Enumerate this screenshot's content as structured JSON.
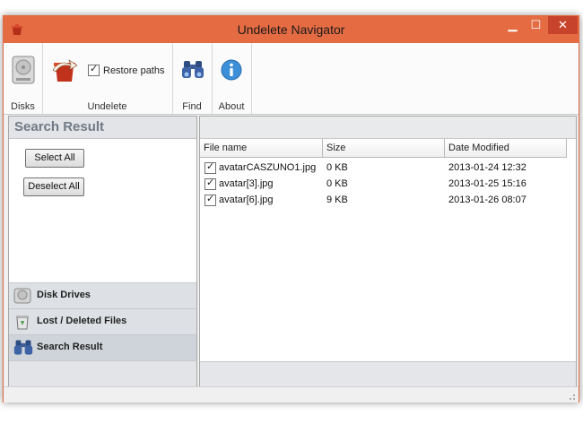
{
  "window": {
    "title": "Undelete Navigator",
    "accent": "#e56b43"
  },
  "controls": {
    "minimize": "▁",
    "maximize": "☐",
    "close": "✕"
  },
  "ribbon": {
    "disks_label": "Disks",
    "undelete_label": "Undelete",
    "restore_paths_label": "Restore paths",
    "restore_paths_checked": true,
    "find_label": "Find",
    "about_label": "About",
    "icons": [
      "hard-disk-icon",
      "undelete-trash-icon",
      "binoculars-icon",
      "info-icon"
    ]
  },
  "left_panel": {
    "header": "Search Result",
    "select_all": "Select All",
    "deselect_all": "Deselect All",
    "nav": [
      {
        "label": "Disk Drives",
        "icon": "hard-disk-icon"
      },
      {
        "label": "Lost / Deleted Files",
        "icon": "recycle-bin-icon"
      },
      {
        "label": "Search Result",
        "icon": "binoculars-icon",
        "active": true
      }
    ]
  },
  "file_list": {
    "columns": [
      "File name",
      "Size",
      "Date Modified"
    ],
    "rows": [
      {
        "checked": true,
        "name": "avatarCASZUNO1.jpg",
        "size": "0 KB",
        "date": "2013-01-24  12:32"
      },
      {
        "checked": true,
        "name": "avatar[3].jpg",
        "size": "0 KB",
        "date": "2013-01-25  15:16"
      },
      {
        "checked": true,
        "name": "avatar[6].jpg",
        "size": "9 KB",
        "date": "2013-01-26  08:07"
      }
    ]
  }
}
